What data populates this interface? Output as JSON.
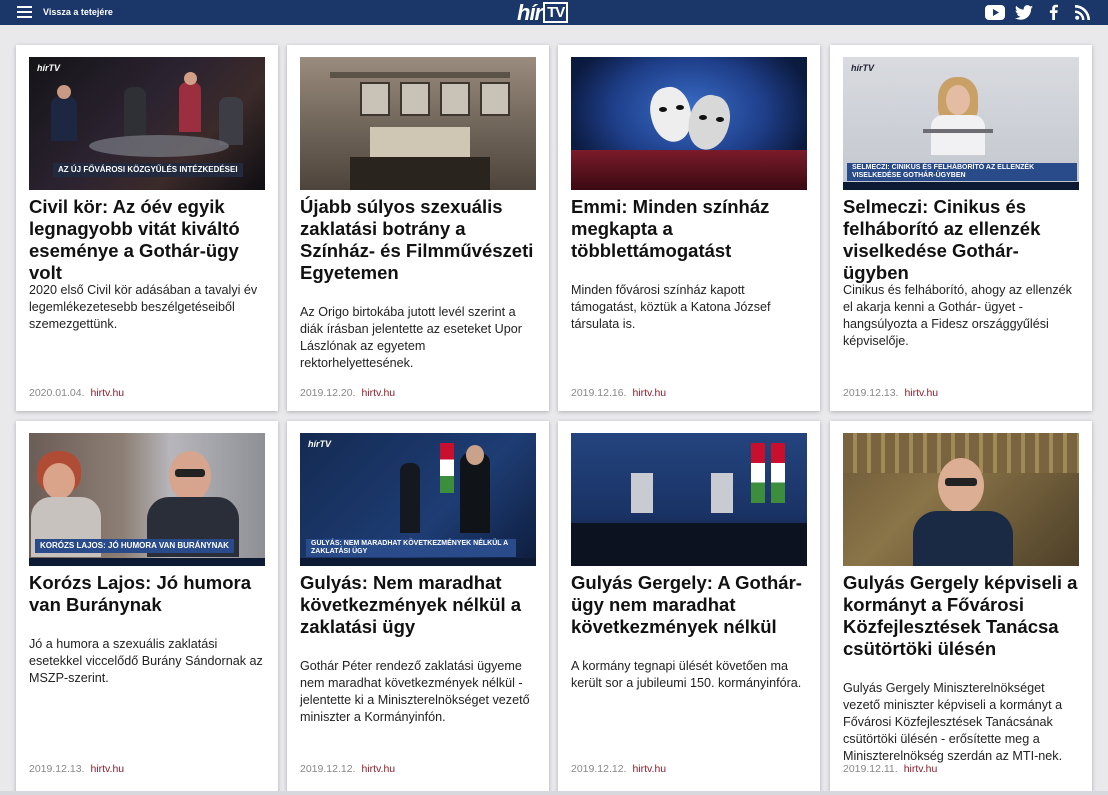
{
  "header": {
    "back_to_top": "Vissza a tetejére",
    "logo_main": "hír",
    "logo_tv": "TV",
    "social_icons": [
      "youtube-icon",
      "twitter-icon",
      "facebook-icon",
      "rss-icon"
    ],
    "bg_color": "#1b3668"
  },
  "articles": [
    {
      "title": "Civil kör: Az óév egyik legnagyobb vitát kiváltó eseménye a Gothár-ügy volt",
      "summary": "2020 első Civil kör adásában a tavalyi év legemlékezetesebb beszélgetéseiből szemezgettünk.",
      "date": "2020.01.04.",
      "source": "hirtv.hu",
      "thumb_caption": "AZ ÚJ FŐVÁROSI KÖZGYŰLÉS INTÉZKEDÉSEI"
    },
    {
      "title": "Újabb súlyos szexuális zaklatási botrány a Színház- és Filmművészeti Egyetemen",
      "summary": "Az Origo birtokába jutott levél szerint a diák írásban jelentette az eseteket Upor Lászlónak az egyetem rektorhelyettesének.",
      "date": "2019.12.20.",
      "source": "hirtv.hu",
      "thumb_caption": ""
    },
    {
      "title": "Emmi: Minden színház megkapta a többlettámogatást",
      "summary": "Minden fővárosi színház kapott támogatást, köztük a Katona József társulata is.",
      "date": "2019.12.16.",
      "source": "hirtv.hu",
      "thumb_caption": ""
    },
    {
      "title": "Selmeczi: Cinikus és felháborító az ellenzék viselkedése Gothár-ügyben",
      "summary": "Cinikus és felháborító, ahogy az ellenzék el akarja kenni a Gothár- ügyet - hangsúlyozta a Fidesz országgyűlési képviselője.",
      "date": "2019.12.13.",
      "source": "hirtv.hu",
      "thumb_caption": "SELMECZI: CINIKUS ÉS FELHÁBORÍTÓ AZ ELLENZÉK VISELKEDÉSE GOTHÁR-ÜGYBEN"
    },
    {
      "title": "Korózs Lajos: Jó humora van Buránynak",
      "summary": "Jó a humora a szexuális zaklatási esetekkel viccelődő Burány Sándornak az MSZP-szerint.",
      "date": "2019.12.13.",
      "source": "hirtv.hu",
      "thumb_caption": "KORÓZS LAJOS: JÓ HUMORA VAN BURÁNYNAK"
    },
    {
      "title": "Gulyás: Nem maradhat következmények nélkül a zaklatási ügy",
      "summary": "Gothár Péter rendező zaklatási ügyeme nem maradhat következmények nélkül - jelentette ki a Miniszterelnökséget vezető miniszter a Kormányinfón.",
      "date": "2019.12.12.",
      "source": "hirtv.hu",
      "thumb_caption": "GULYÁS: NEM MARADHAT KÖVETKEZMÉNYEK NÉLKÜL A ZAKLATÁSI ÜGY"
    },
    {
      "title": "Gulyás Gergely: A Gothár-ügy nem maradhat következmények nélkül",
      "summary": "A kormány tegnapi ülését követően ma került sor a jubileumi 150. kormányinfóra.",
      "date": "2019.12.12.",
      "source": "hirtv.hu",
      "thumb_caption": ""
    },
    {
      "title": "Gulyás Gergely képviseli a kormányt a Fővárosi Közfejlesztések Tanácsa csütörtöki ülésén",
      "summary": "Gulyás Gergely Miniszterelnökséget vezető miniszter képviseli a kormányt a Fővárosi Közfejlesztések Tanácsának csütörtöki ülésén - erősítette meg a Miniszterelnökség szerdán az MTI-nek.",
      "date": "2019.12.11.",
      "source": "hirtv.hu",
      "thumb_caption": ""
    }
  ]
}
